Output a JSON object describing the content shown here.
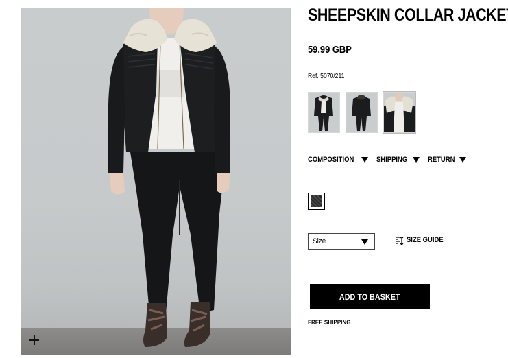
{
  "product": {
    "title": "SHEEPSKIN COLLAR JACKET",
    "price": "59.99 GBP",
    "ref": "Ref. 5070/211",
    "image_alt": "Model wearing black leather jacket with sheepskin collar, white lace top, black jeans and snakeskin ankle boots"
  },
  "thumbnails": [
    {
      "name": "front view"
    },
    {
      "name": "back view"
    },
    {
      "name": "collar detail"
    }
  ],
  "info_tabs": {
    "composition": "COMPOSITION",
    "shipping": "SHIPPING",
    "return": "RETURN"
  },
  "color": {
    "selected": "black",
    "swatch_colors": [
      "#2a2a2a",
      "#4a4a4a"
    ]
  },
  "size": {
    "label": "Size",
    "size_guide": "SIZE GUIDE"
  },
  "actions": {
    "add_to_basket": "ADD TO BASKET",
    "free_shipping": "FREE SHIPPING"
  },
  "icons": {
    "zoom": "plus-icon",
    "dropdown": "triangle-down-icon",
    "size_guide": "ruler-icon"
  }
}
